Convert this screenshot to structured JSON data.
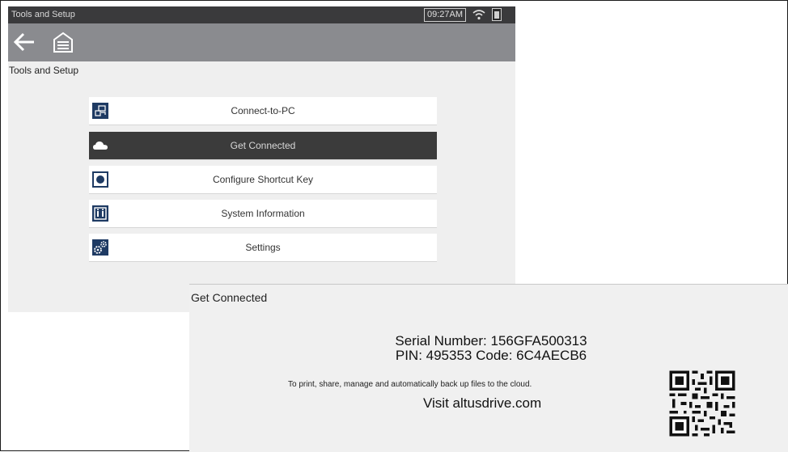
{
  "statusbar": {
    "title": "Tools and Setup",
    "time": "09:27AM"
  },
  "page": {
    "title": "Tools and Setup"
  },
  "menu": {
    "items": [
      {
        "label": "Connect-to-PC"
      },
      {
        "label": "Get Connected"
      },
      {
        "label": "Configure Shortcut Key"
      },
      {
        "label": "System Information"
      },
      {
        "label": "Settings"
      }
    ]
  },
  "get_connected": {
    "title": "Get Connected",
    "serial_line": "Serial Number: 156GFA500313",
    "pin_line": "PIN: 495353  Code: 6C4AECB6",
    "description": "To print, share, manage and automatically back up files to the cloud.",
    "visit": "Visit altusdrive.com"
  },
  "colors": {
    "status_bar": "#3a3a3c",
    "nav_bar": "#8a8b8f",
    "selected_item": "#3b3b3b",
    "icon_blue": "#1e3a63"
  },
  "icons": [
    "back-arrow-icon",
    "home-garage-icon",
    "wifi-icon",
    "battery-icon",
    "connect-pc-icon",
    "cloud-icon",
    "shortcut-key-icon",
    "system-info-icon",
    "settings-gears-icon",
    "qr-code"
  ]
}
